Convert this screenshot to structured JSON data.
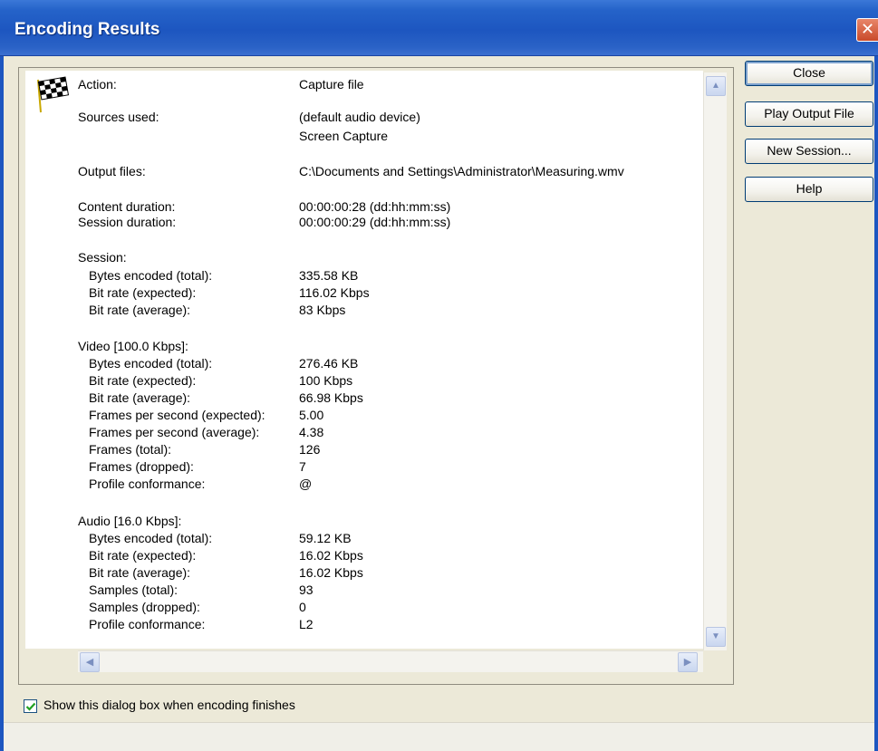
{
  "window": {
    "title": "Encoding Results",
    "close_glyph": "✕"
  },
  "details": [
    {
      "label": "Action:",
      "value": "Capture file"
    },
    {
      "label": "Sources used:",
      "value": "(default audio device)"
    },
    {
      "label": "",
      "value": "Screen Capture"
    },
    {
      "label": "Output files:",
      "value": "C:\\Documents and Settings\\Administrator\\Measuring.wmv"
    },
    {
      "label": "Content duration:",
      "value": "00:00:00:28  (dd:hh:mm:ss)"
    },
    {
      "label": "Session duration:",
      "value": "00:00:00:29  (dd:hh:mm:ss)"
    },
    {
      "label": "Session:",
      "value": ""
    },
    {
      "label": "Bytes encoded (total):",
      "value": "335.58 KB"
    },
    {
      "label": "Bit rate (expected):",
      "value": "116.02 Kbps"
    },
    {
      "label": "Bit rate (average):",
      "value": "83 Kbps"
    },
    {
      "label": "Video [100.0 Kbps]:",
      "value": ""
    },
    {
      "label": "Bytes encoded (total):",
      "value": "276.46 KB"
    },
    {
      "label": "Bit rate (expected):",
      "value": "100 Kbps"
    },
    {
      "label": "Bit rate (average):",
      "value": "66.98 Kbps"
    },
    {
      "label": "Frames per second (expected):",
      "value": "5.00"
    },
    {
      "label": "Frames per second (average):",
      "value": "4.38"
    },
    {
      "label": "Frames (total):",
      "value": "126"
    },
    {
      "label": "Frames (dropped):",
      "value": "7"
    },
    {
      "label": "Profile conformance:",
      "value": "@"
    },
    {
      "label": "Audio [16.0 Kbps]:",
      "value": ""
    },
    {
      "label": "Bytes encoded (total):",
      "value": "59.12 KB"
    },
    {
      "label": "Bit rate (expected):",
      "value": "16.02 Kbps"
    },
    {
      "label": "Bit rate (average):",
      "value": "16.02 Kbps"
    },
    {
      "label": "Samples (total):",
      "value": "93"
    },
    {
      "label": "Samples (dropped):",
      "value": "0"
    },
    {
      "label": "Profile conformance:",
      "value": "L2"
    }
  ],
  "buttons": {
    "close": "Close",
    "play_output": "Play Output File",
    "new_session": "New Session...",
    "help": "Help"
  },
  "scroll": {
    "up": "▲",
    "down": "▼",
    "left": "◀",
    "right": "▶"
  },
  "options": {
    "show_dialog_label": "Show this dialog box when encoding finishes",
    "show_dialog_checked": true
  },
  "icons": {
    "status_flag": "checkered-flag-icon"
  }
}
